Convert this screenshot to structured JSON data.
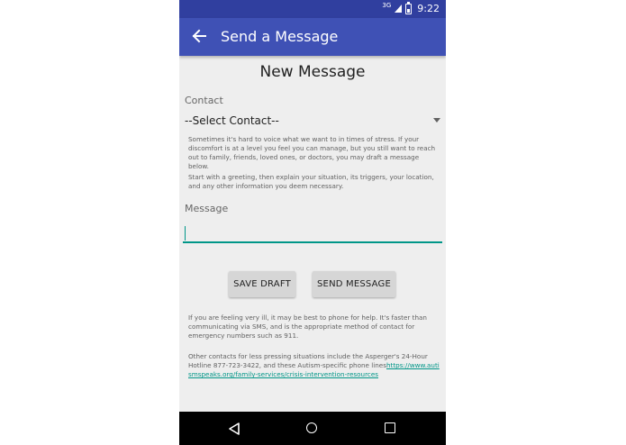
{
  "status_bar": {
    "network": "3G",
    "time": "9:22"
  },
  "app_bar": {
    "title": "Send a Message",
    "back_icon": "arrow-left-icon"
  },
  "form": {
    "heading": "New Message",
    "contact_label": "Contact",
    "contact_selected": "--Select Contact--",
    "info_paragraph_1": "Sometimes it's hard to voice what we want to in times of stress. If your discomfort is at a level you feel you can manage, but you still want to reach out to family, friends, loved ones, or doctors, you may draft a message below.",
    "info_paragraph_2": "Start with a greeting, then explain your situation, its triggers, your location, and any other information you deem necessary.",
    "message_label": "Message",
    "message_value": ""
  },
  "buttons": {
    "save_draft": "SAVE DRAFT",
    "send_message": "SEND MESSAGE"
  },
  "help": {
    "paragraph_1": "If you are feeling very ill, it may be best to phone for help. It's faster than communicating via SMS, and is the appropriate method of contact for emergency numbers such as 911.",
    "paragraph_2_text": "Other contacts for less pressing situations include the Asperger's 24-Hour Hotline 877-723-3422, and these Autism-specific phone lines",
    "paragraph_2_link": "https://www.autismspeaks.org/family-services/crisis-intervention-resources"
  },
  "nav_bar": {
    "back_icon": "triangle-back-icon",
    "home_icon": "circle-home-icon",
    "recents_icon": "square-recents-icon"
  },
  "colors": {
    "app_bar": "#3f51b5",
    "status_bar": "#303f9f",
    "accent": "#009688",
    "background": "#eeeeee"
  }
}
